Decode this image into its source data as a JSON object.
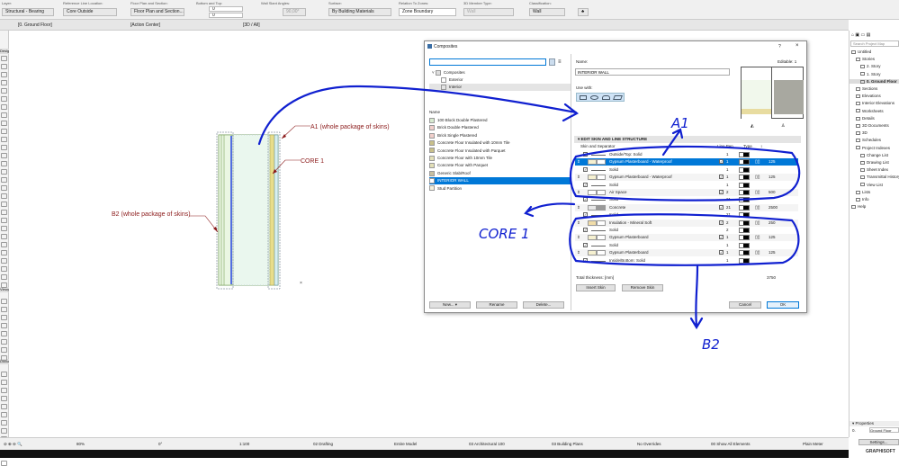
{
  "infobox": {
    "groups": [
      {
        "label": "Layer:",
        "value": "Structural - Bearing"
      },
      {
        "label": "Reference Line Location:",
        "value": "Core Outside"
      },
      {
        "label": "Floor Plan and Section:",
        "value": "Floor Plan and Section..."
      },
      {
        "label": "Bottom and Top:",
        "value_top": "0",
        "value_bottom": "0"
      },
      {
        "label": "Wall Slant Angles:",
        "value": "90,00°"
      },
      {
        "label": "Surface:",
        "value": "By Building Materials"
      },
      {
        "label": "Relation To Zones:",
        "value": "Zone Boundary"
      },
      {
        "label": "3D Member Type:",
        "value": "Wall"
      },
      {
        "label": "Classification:",
        "value": "Wall"
      }
    ]
  },
  "tabs": [
    {
      "label": "[0. Ground Floor]",
      "active": true
    },
    {
      "label": "[Action Center]",
      "active": false
    },
    {
      "label": "[3D / All]",
      "active": false
    }
  ],
  "toolbox": {
    "headers": [
      "Design",
      "Viewpoint",
      "Document"
    ]
  },
  "drawing": {
    "annotations": [
      {
        "id": "a1",
        "text": "A1 (whole package of skins)"
      },
      {
        "id": "core",
        "text": "CORE 1"
      },
      {
        "id": "b2",
        "text": "B2 (whole package of skins)"
      }
    ],
    "handwritten": [
      "A1",
      "CORE 1",
      "B2"
    ]
  },
  "dialog": {
    "title": "Composites",
    "help": "?",
    "close": "×",
    "search_value": "",
    "tree": [
      {
        "label": "Composites",
        "expanded": true
      },
      {
        "label": "Exterior"
      },
      {
        "label": "Interior"
      }
    ],
    "list_header": "Name",
    "list": [
      {
        "label": "100 Block Double Plastered",
        "color": "#d8ead0"
      },
      {
        "label": "Brick Double Plastered",
        "color": "#f2d0cc"
      },
      {
        "label": "Brick Single Plastered",
        "color": "#f2d0cc"
      },
      {
        "label": "Concrete Floor Insulated with 10mm Tile",
        "color": "#c9c08a"
      },
      {
        "label": "Concrete Floor Insulated with Parquet",
        "color": "#c9c08a"
      },
      {
        "label": "Concrete Floor with 10mm Tile",
        "color": "#e3e0b8"
      },
      {
        "label": "Concrete Floor with Parquet",
        "color": "#e3e0b8"
      },
      {
        "label": "Generic Slab/Roof",
        "color": "#c8c0a0"
      },
      {
        "label": "INTERIOR WALL",
        "color": "#ffffff",
        "selected": true
      },
      {
        "label": "Stud Partition",
        "color": "#f4f0dc"
      }
    ],
    "buttons": {
      "new": "New...",
      "rename": "Rename",
      "delete": "Delete..."
    },
    "name_label": "Name:",
    "name_value": "INTERIOR WALL",
    "editable": "Editable: 1",
    "use_with": "Use with:",
    "section_title": "EDIT SKIN AND LINE STRUCTURE",
    "columns": {
      "skin": "Skin and Separator",
      "pen": "Line Pen",
      "type": "Type",
      "thickness": "↕"
    },
    "skins": [
      {
        "kind": "line",
        "label": "Outside/Top: Solid",
        "pen": "1"
      },
      {
        "kind": "skin",
        "label": "Gypsum Plasterboard - Waterproof",
        "pen": "1",
        "thickness": "125",
        "selected": true,
        "fill": "#f5f0d0"
      },
      {
        "kind": "line",
        "label": "Solid",
        "pen": "1"
      },
      {
        "kind": "skin",
        "label": "Gypsum Plasterboard - Waterproof",
        "pen": "1",
        "thickness": "125",
        "fill": "#f5f0d0"
      },
      {
        "kind": "line",
        "label": "Solid",
        "pen": "1"
      },
      {
        "kind": "skin",
        "label": "Air Space",
        "pen": "2",
        "thickness": "500",
        "fill": "#ffffff"
      },
      {
        "kind": "line",
        "label": "Solid",
        "pen": "21"
      },
      {
        "kind": "skin",
        "label": "Concrete",
        "pen": "21",
        "thickness": "2500",
        "fill": "#e8e8e8",
        "core": true
      },
      {
        "kind": "line",
        "label": "Solid",
        "pen": "21"
      },
      {
        "kind": "skin",
        "label": "Insulation - Mineral Soft",
        "pen": "2",
        "thickness": "250",
        "fill": "#f0dca8"
      },
      {
        "kind": "line",
        "label": "Solid",
        "pen": "2"
      },
      {
        "kind": "skin",
        "label": "Gypsum Plasterboard",
        "pen": "1",
        "thickness": "125",
        "fill": "#f5f0d0"
      },
      {
        "kind": "line",
        "label": "Solid",
        "pen": "1"
      },
      {
        "kind": "skin",
        "label": "Gypsum Plasterboard",
        "pen": "1",
        "thickness": "125",
        "fill": "#f5f0d0"
      },
      {
        "kind": "line",
        "label": "Inside/Bottom: Solid",
        "pen": "1"
      }
    ],
    "total_label": "Total thickness: [mm]",
    "total_value": "3750",
    "insert_skin": "Insert Skin",
    "remove_skin": "Remove Skin",
    "cancel": "Cancel",
    "ok": "OK"
  },
  "navigator": {
    "search_placeholder": "Search Project Map",
    "items": [
      {
        "label": "Untitled",
        "indent": 0
      },
      {
        "label": "Stories",
        "indent": 1
      },
      {
        "label": "2. Story",
        "indent": 2
      },
      {
        "label": "1. Story",
        "indent": 2
      },
      {
        "label": "0. Ground Floor",
        "indent": 2,
        "selected": true
      },
      {
        "label": "Sections",
        "indent": 1
      },
      {
        "label": "Elevations",
        "indent": 1
      },
      {
        "label": "Interior Elevations",
        "indent": 1
      },
      {
        "label": "Worksheets",
        "indent": 1
      },
      {
        "label": "Details",
        "indent": 1
      },
      {
        "label": "3D Documents",
        "indent": 1
      },
      {
        "label": "3D",
        "indent": 1
      },
      {
        "label": "Schedules",
        "indent": 1
      },
      {
        "label": "Project Indexes",
        "indent": 1
      },
      {
        "label": "Change List",
        "indent": 2
      },
      {
        "label": "Drawing List",
        "indent": 2
      },
      {
        "label": "Sheet Index",
        "indent": 2
      },
      {
        "label": "Transmittal History",
        "indent": 2
      },
      {
        "label": "View List",
        "indent": 2
      },
      {
        "label": "Lists",
        "indent": 1
      },
      {
        "label": "Info",
        "indent": 1
      },
      {
        "label": "Help",
        "indent": 0
      }
    ],
    "properties_label": "Properties",
    "prop_id": "0.",
    "prop_value": "Ground Floor",
    "settings": "Settings...",
    "brand": "GRAPHISOFT"
  },
  "statusbar": {
    "zoom": "80%",
    "angle": "0°",
    "scale": "1:100",
    "layer_combo": "02 Drafting",
    "structure": "Entire Model",
    "pen_set": "03 Architectural 100",
    "mvo": "03 Building Plans",
    "overrides": "No Overrides",
    "renovation": "00 Show All Elements",
    "dimension": "Plain Meter"
  },
  "colors": {
    "accent": "#0078d7",
    "annotation": "#8b1a1a",
    "handwriting": "#1020d0"
  }
}
